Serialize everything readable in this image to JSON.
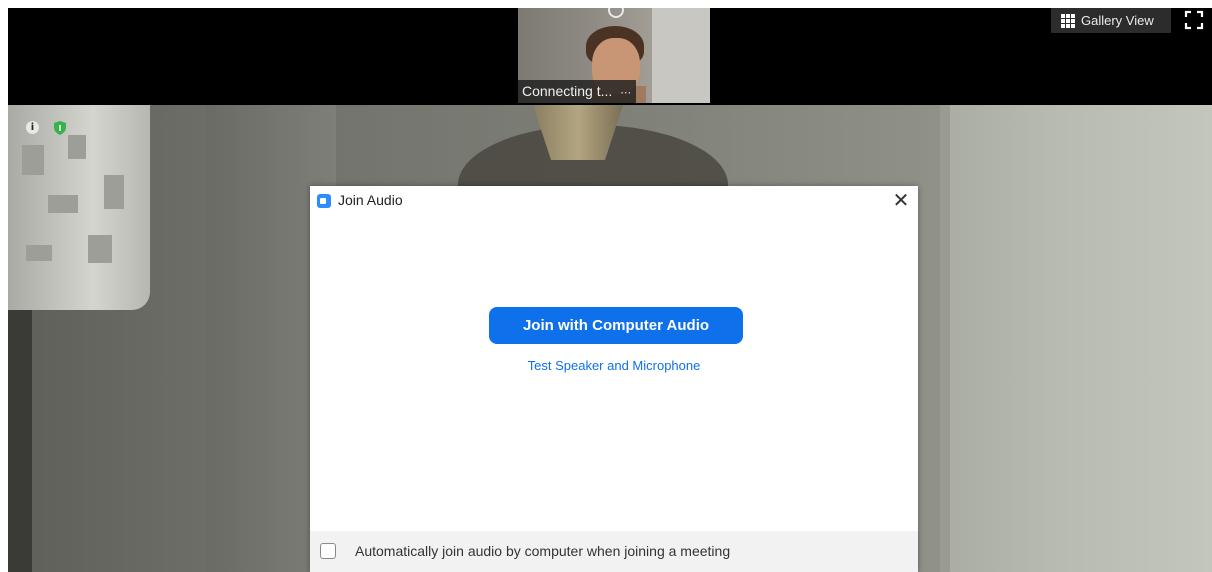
{
  "top_bar": {
    "thumbnail_label": "Connecting t...",
    "gallery_view_label": "Gallery View"
  },
  "icons": {
    "info": "info-icon",
    "shield": "shield-icon",
    "grid": "grid-icon",
    "fullscreen": "fullscreen-icon",
    "zoom": "zoom-icon",
    "close": "close-icon"
  },
  "dialog": {
    "title": "Join Audio",
    "close_glyph": "✕",
    "primary_button": "Join with Computer Audio",
    "secondary_link": "Test Speaker and Microphone",
    "checkbox_label": "Automatically join audio by computer when joining a meeting",
    "checkbox_checked": false
  },
  "colors": {
    "accent": "#0e71eb",
    "zoom_icon": "#2d8cff",
    "shield": "#35b34a"
  }
}
